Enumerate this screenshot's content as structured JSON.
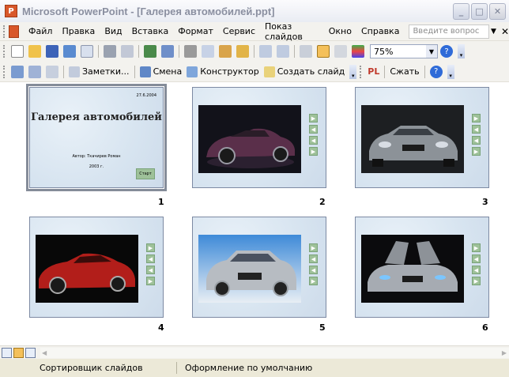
{
  "window": {
    "title": "Microsoft PowerPoint - [Галерея автомобилей.ppt]"
  },
  "menu": {
    "items": [
      "Файл",
      "Правка",
      "Вид",
      "Вставка",
      "Формат",
      "Сервис",
      "Показ слайдов",
      "Окно",
      "Справка"
    ],
    "help_placeholder": "Введите вопрос"
  },
  "toolbar": {
    "zoom": "75%"
  },
  "toolbar2": {
    "notes": "Заметки...",
    "transition": "Смена",
    "designer": "Конструктор",
    "new_slide": "Создать слайд",
    "pl": "PL",
    "compress": "Сжать"
  },
  "slides": [
    {
      "num": "1",
      "title": "Галерея автомобилей",
      "date": "27.6.2004",
      "author": "Автор: Ткачирев Роман",
      "year": "2003 г.",
      "button": "Старт"
    },
    {
      "num": "2",
      "photo": "dark-roadster-photo"
    },
    {
      "num": "3",
      "photo": "grey-sedan-photo"
    },
    {
      "num": "4",
      "photo": "red-sports-car-photo"
    },
    {
      "num": "5",
      "photo": "silver-suv-photo"
    },
    {
      "num": "6",
      "photo": "silver-concept-car-photo"
    }
  ],
  "status": {
    "view": "Сортировщик слайдов",
    "design": "Оформление по умолчанию"
  },
  "colors": {
    "slide_bg": "#dde8f3",
    "nav_btn": "#9ec199",
    "selection": "#858c99"
  }
}
